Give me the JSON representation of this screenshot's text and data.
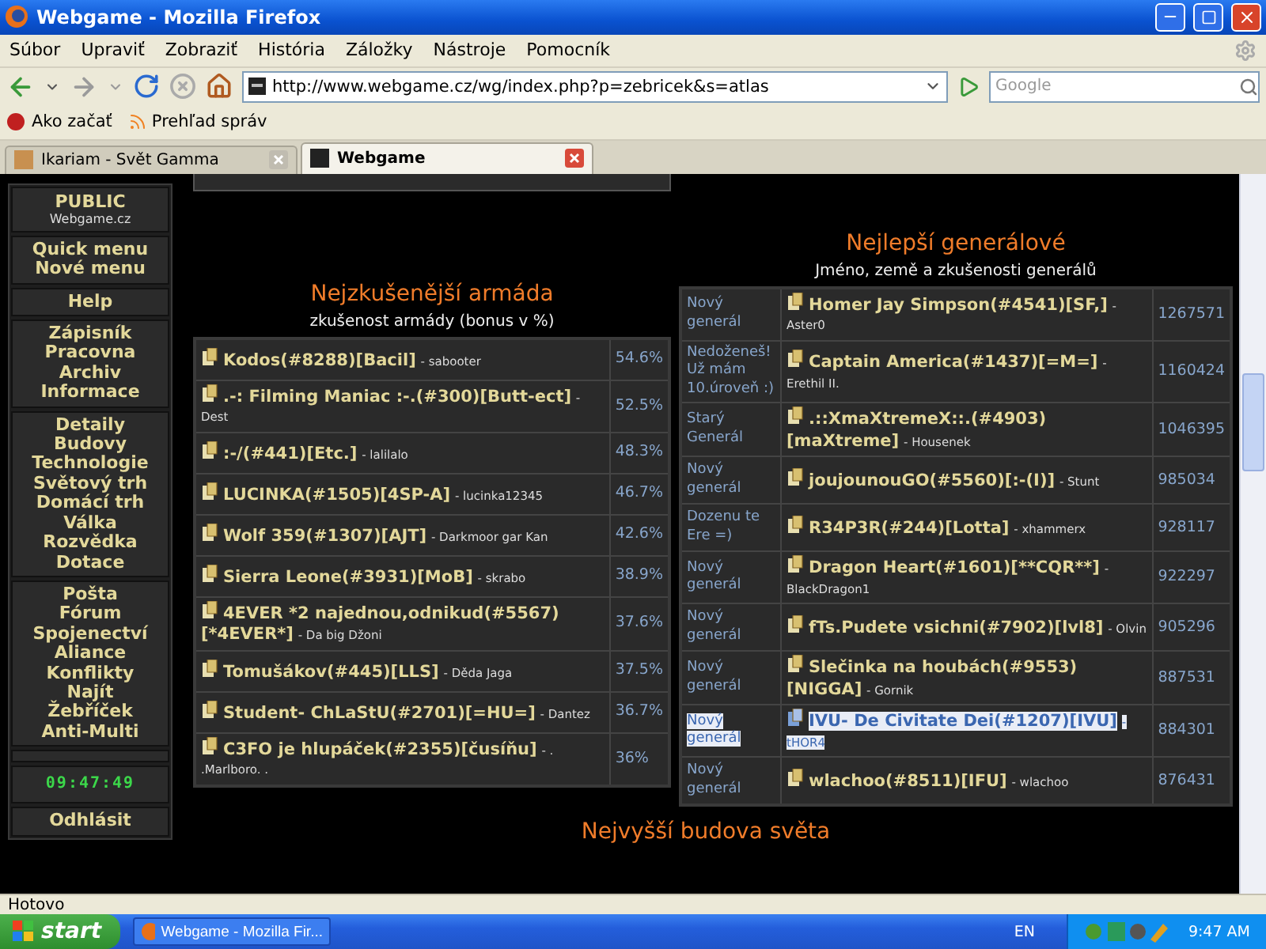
{
  "window": {
    "title": "Webgame - Mozilla Firefox"
  },
  "menu": [
    "Súbor",
    "Upraviť",
    "Zobraziť",
    "História",
    "Záložky",
    "Nástroje",
    "Pomocník"
  ],
  "address": {
    "url": "http://www.webgame.cz/wg/index.php?p=zebricek&s=atlas"
  },
  "search": {
    "placeholder": "Google"
  },
  "bookmarks": [
    "Ako začať",
    "Prehľad správ"
  ],
  "tabs": [
    {
      "label": "Ikariam - Svět Gamma",
      "selected": false
    },
    {
      "label": "Webgame",
      "selected": true
    }
  ],
  "sidebar": {
    "groups": [
      {
        "kind": "brand",
        "items": [
          "PUBLIC",
          "Webgame.cz"
        ]
      },
      {
        "kind": "links",
        "items": [
          "Quick menu",
          "Nové menu"
        ]
      },
      {
        "kind": "links",
        "items": [
          "Help"
        ]
      },
      {
        "kind": "links",
        "items": [
          "Zápisník",
          "Pracovna",
          "Archiv",
          "Informace"
        ]
      },
      {
        "kind": "links",
        "items": [
          "Detaily",
          "Budovy",
          "Technologie",
          "Světový trh",
          "Domácí trh",
          "Válka",
          "Rozvědka",
          "Dotace"
        ]
      },
      {
        "kind": "links",
        "items": [
          "Pošta",
          "Fórum",
          "Spojenectví",
          "Aliance",
          "Konflikty",
          "Najít",
          "Žebříček",
          "Anti-Multi"
        ]
      },
      {
        "kind": "spacer"
      },
      {
        "kind": "clock",
        "items": [
          "09:47:49"
        ]
      },
      {
        "kind": "links",
        "items": [
          "Odhlásit"
        ]
      }
    ]
  },
  "army": {
    "heading": "Nejzkušenější armáda",
    "subtitle": "zkušenost armády (bonus v %)",
    "rows": [
      {
        "name": "Kodos(#8288)[Bacil]",
        "player": "- sabooter",
        "value": "54.6%"
      },
      {
        "name": ".-: Filming Maniac :-.(#300)[Butt-ect]",
        "player": "- Dest",
        "value": "52.5%"
      },
      {
        "name": ":-/(#441)[Etc.]",
        "player": "- lalilalo",
        "value": "48.3%"
      },
      {
        "name": "LUCINKA(#1505)[4SP-A]",
        "player": "- lucinka12345",
        "value": "46.7%"
      },
      {
        "name": "Wolf 359(#1307)[AJT]",
        "player": "- Darkmoor gar Kan",
        "value": "42.6%"
      },
      {
        "name": "Sierra Leone(#3931)[MoB]",
        "player": "- skrabo",
        "value": "38.9%"
      },
      {
        "name": "4EVER *2 najednou,odnikud(#5567)[*4EVER*]",
        "player": "- Da big Džoni",
        "value": "37.6%"
      },
      {
        "name": "Tomušákov(#445)[LLS]",
        "player": "- Děda Jaga",
        "value": "37.5%"
      },
      {
        "name": "Student- ChLaStU(#2701)[=HU=]",
        "player": "- Dantez",
        "value": "36.7%"
      },
      {
        "name": "C3FO je hlupáček(#2355)[čusíňu]",
        "player": "- . .Marlboro. .",
        "value": "36%"
      }
    ]
  },
  "generals": {
    "heading": "Nejlepší generálové",
    "subtitle": "Jméno, země a zkušenosti generálů",
    "rows": [
      {
        "rank": "Nový generál",
        "name": "Homer Jay Simpson(#4541)[SF,]",
        "player": "- Aster0",
        "score": "1267571",
        "selected": false
      },
      {
        "rank": "Nedoženeš! Už mám 10.úroveň :)",
        "name": "Captain America(#1437)[=M=]",
        "player": "- Erethil II.",
        "score": "1160424",
        "selected": false
      },
      {
        "rank": "Starý Generál",
        "name": ".::XmaXtremeX::.(#4903)[maXtreme]",
        "player": "- Housenek",
        "score": "1046395",
        "selected": false
      },
      {
        "rank": "Nový generál",
        "name": "joujounouGO(#5560)[:-(I)]",
        "player": "- Stunt",
        "score": "985034",
        "selected": false
      },
      {
        "rank": "Dozenu te Ere =)",
        "name": "R34P3R(#244)[Lotta]",
        "player": "- xhammerx",
        "score": "928117",
        "selected": false
      },
      {
        "rank": "Nový generál",
        "name": "Dragon Heart(#1601)[**CQR**]",
        "player": "- BlackDragon1",
        "score": "922297",
        "selected": false
      },
      {
        "rank": "Nový generál",
        "name": "fTs.Pudete vsichni(#7902)[lvl8]",
        "player": "- Olvin",
        "score": "905296",
        "selected": false
      },
      {
        "rank": "Nový generál",
        "name": "Slečinka na houbách(#9553)[NIGGA]",
        "player": "- Gornik",
        "score": "887531",
        "selected": false
      },
      {
        "rank": "Nový generál",
        "name": "IVU- De Civitate Dei(#1207)[IVU]",
        "player": "- tHOR4",
        "score": "884301",
        "selected": true
      },
      {
        "rank": "Nový generál",
        "name": "wlachoo(#8511)[IFU]",
        "player": "- wlachoo",
        "score": "876431",
        "selected": false
      }
    ]
  },
  "next_heading": "Nejvyšší budova světa",
  "status_bar": "Hotovo",
  "taskbar": {
    "start": "start",
    "task": "Webgame - Mozilla Fir...",
    "language": "EN",
    "time": "9:47 AM"
  }
}
